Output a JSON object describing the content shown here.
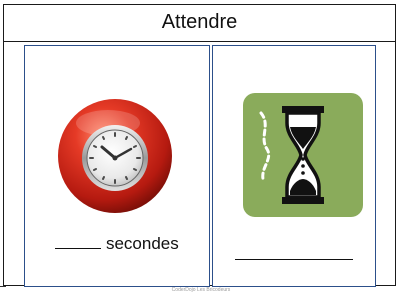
{
  "card": {
    "title": "Attendre"
  },
  "left_panel": {
    "icon": "clock-icon",
    "label": "secondes"
  },
  "right_panel": {
    "icon": "hourglass-icon"
  },
  "footer": {
    "text": "CoderDojo Les Bricodeurs"
  },
  "colors": {
    "clock_red": "#d3241a",
    "hourglass_bg": "#8aab5b",
    "panel_border": "#2c4f8a"
  }
}
